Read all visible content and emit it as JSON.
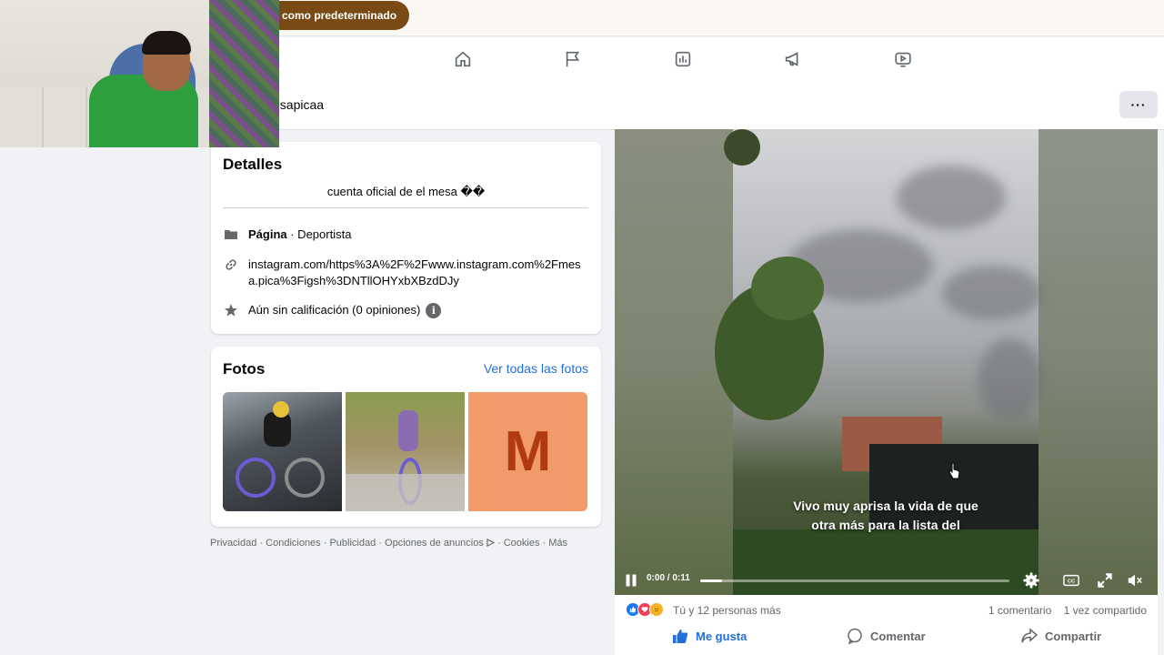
{
  "topbar": {
    "pill_label": "como predeterminado"
  },
  "nav": {
    "icons": [
      "home-icon",
      "flag-icon",
      "insights-icon",
      "megaphone-icon",
      "video-icon"
    ]
  },
  "page": {
    "name": "esapicaa",
    "more_label": "···"
  },
  "details": {
    "title": "Detalles",
    "bio": "cuenta oficial de el mesa ��",
    "category_bold": "Página",
    "category_rest": " · Deportista",
    "link": "instagram.com/https%3A%2F%2Fwww.instagram.com%2Fmesa.pica%3Figsh%3DNTllOHYxbXBzdDJy",
    "rating": "Aún sin calificación (0 opiniones)",
    "info_glyph": "i"
  },
  "photos": {
    "title": "Fotos",
    "see_all": "Ver todas las fotos",
    "tile_letter": "M"
  },
  "footer": {
    "links": [
      "Privacidad",
      "Condiciones",
      "Publicidad",
      "Opciones de anuncios",
      "Cookies",
      "Más"
    ]
  },
  "video": {
    "subtitle_line1": "Vivo muy aprisa la vida de que",
    "subtitle_line2": "otra más para la lista del",
    "time": "0:00 / 0:11",
    "progress": 0.07
  },
  "post": {
    "reactions_text": "Tú y 12 personas más",
    "comments": "1 comentario",
    "shares": "1 vez compartido",
    "like_label": "Me gusta",
    "comment_label": "Comentar",
    "share_label": "Compartir"
  },
  "colors": {
    "accent": "#216fdb",
    "pill": "#7a4a14",
    "tile": "#f19b6a",
    "tile_letter": "#b23a10"
  }
}
